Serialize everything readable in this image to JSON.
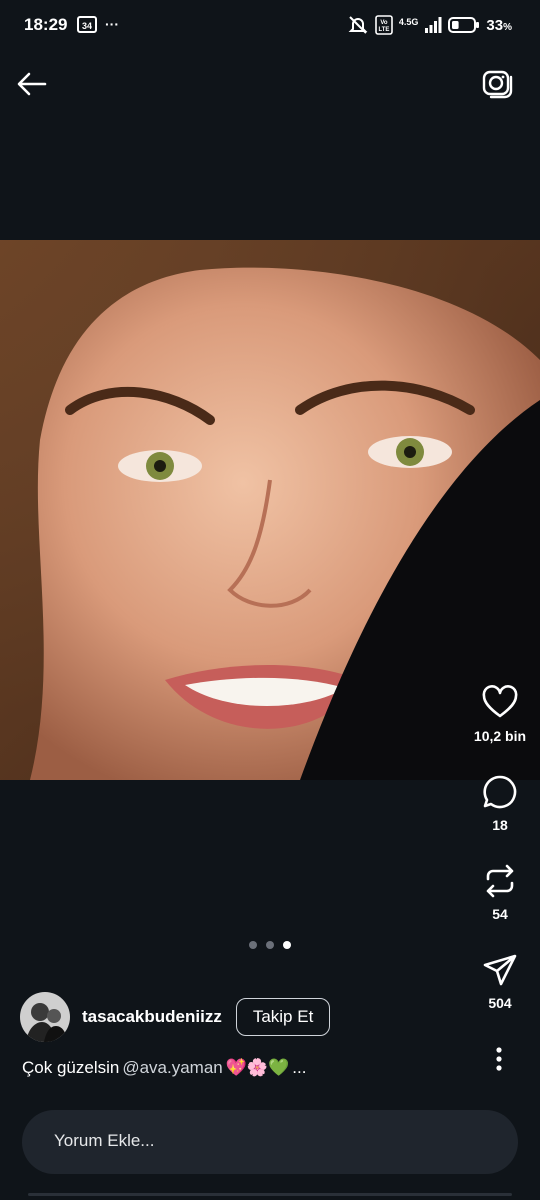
{
  "status": {
    "time": "18:29",
    "notification_badge": "34",
    "more": "···",
    "network_label": "4.5G",
    "volte": "Vo LTE",
    "battery_percent": "33",
    "battery_unit": "%",
    "battery_level": 0.33
  },
  "nav": {
    "back_icon": "arrow-left-icon",
    "camera_icon": "camera-flip-icon"
  },
  "carousel": {
    "total": 3,
    "active_index": 2
  },
  "actions": {
    "likes": "10,2 bin",
    "replies": "18",
    "reposts": "54",
    "shares": "504"
  },
  "post": {
    "username": "tasacakbudeniizz",
    "follow_label": "Takip Et",
    "caption_text": "Çok güzelsin",
    "caption_mention": "@ava.yaman",
    "caption_emojis": "💖🌸💚",
    "caption_more": "..."
  },
  "comment": {
    "placeholder": "Yorum Ekle..."
  },
  "colors": {
    "background": "#0f1419",
    "comment_bar": "#1f252d"
  }
}
